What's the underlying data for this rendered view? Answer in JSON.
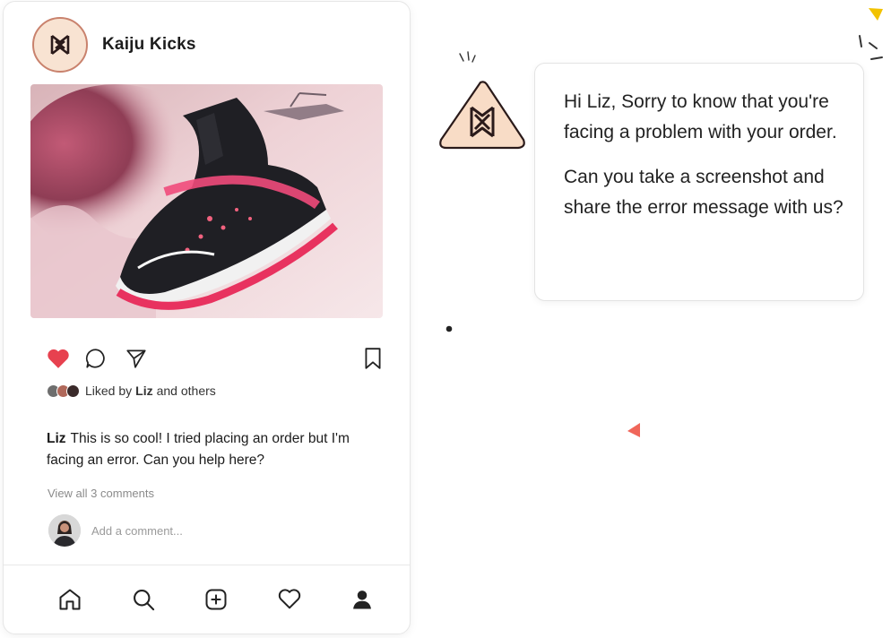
{
  "post": {
    "brand_name": "Kaiju Kicks",
    "liked_by_prefix": "Liked by ",
    "liked_by_user": "Liz",
    "liked_by_suffix": " and others",
    "caption_user": "Liz",
    "caption_text": "This is so cool! I tried placing an order but I'm facing an error. Can you help here?",
    "view_comments": "View all 3 comments",
    "comment_placeholder": "Add a comment..."
  },
  "reply": {
    "paragraph_1": "Hi Liz, Sorry to know that you're facing a problem with your order.",
    "paragraph_2": "Can you take a screenshot and share the error message with us?"
  },
  "colors": {
    "like_red": "#e7414f",
    "brand_peach": "#f8e3d2",
    "accent_yellow": "#f2c200",
    "accent_coral": "#f0665a"
  },
  "icons": {
    "brand": "kaiju-logo-icon",
    "like": "heart-filled-icon",
    "comment": "comment-bubble-icon",
    "share": "send-icon",
    "save": "bookmark-icon",
    "home": "home-icon",
    "search": "search-icon",
    "add": "add-post-icon",
    "activity": "heart-outline-icon",
    "profile": "profile-icon"
  }
}
